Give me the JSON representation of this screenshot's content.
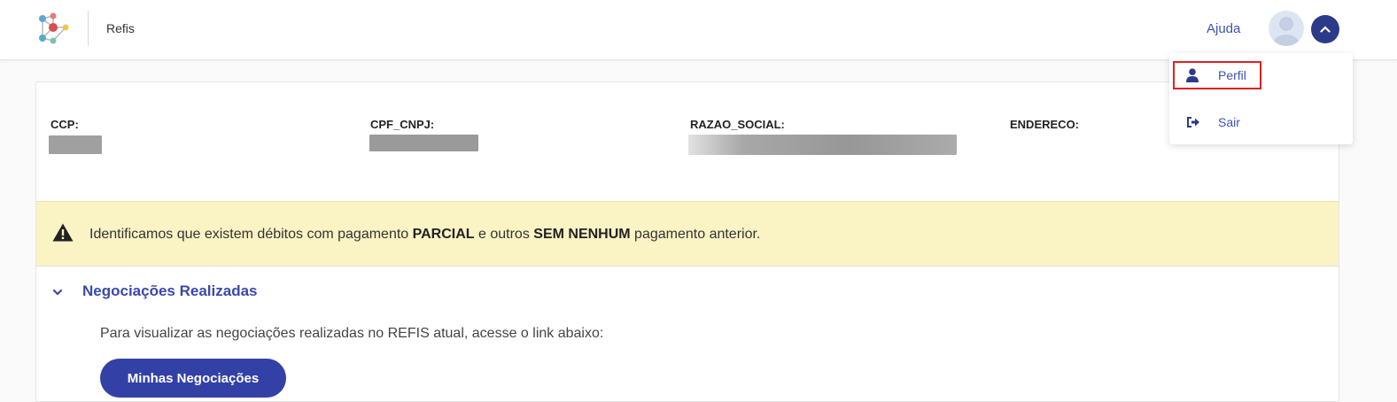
{
  "header": {
    "app_name": "Refis",
    "help_label": "Ajuda",
    "logo_icon": "network-logo-icon",
    "avatar_icon": "user-avatar-icon",
    "toggle_icon": "chevron-up-icon"
  },
  "user_menu": {
    "items": [
      {
        "label": "Perfil",
        "icon": "user-icon"
      },
      {
        "label": "Sair",
        "icon": "logout-icon"
      }
    ]
  },
  "info": {
    "fields": [
      {
        "label": "CCP:"
      },
      {
        "label": "CPF_CNPJ:"
      },
      {
        "label": "RAZAO_SOCIAL:"
      },
      {
        "label": "ENDERECO:"
      }
    ]
  },
  "alert": {
    "icon": "warning-icon",
    "text_before": "Identificamos que existem débitos com pagamento ",
    "strong_1": "PARCIAL",
    "text_middle": " e outros ",
    "strong_2": "SEM NENHUM",
    "text_after": " pagamento anterior."
  },
  "section": {
    "title": "Negociações Realizadas",
    "toggle_icon": "chevron-down-icon",
    "description": "Para visualizar as negociações realizadas no REFIS atual, acesse o link abaixo:",
    "button_label": "Minhas Negociações"
  },
  "colors": {
    "primary": "#3341a6",
    "link": "#3f51b5",
    "alert_bg": "#faf3c4",
    "highlight_border": "#e02020"
  }
}
